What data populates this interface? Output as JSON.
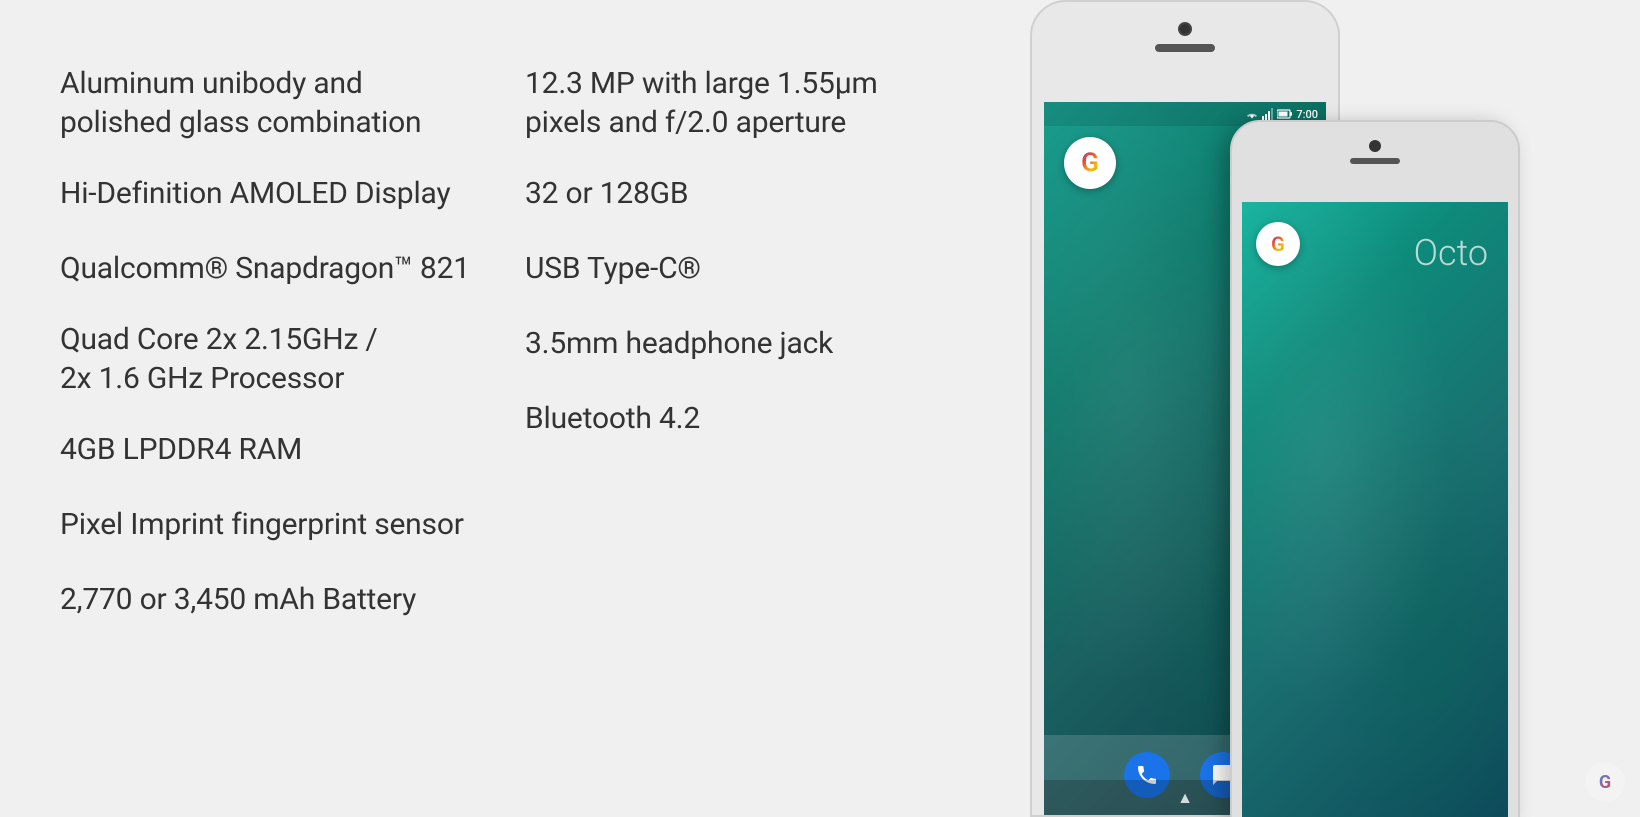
{
  "specs": {
    "left_column": [
      {
        "text": "Aluminum unibody and polished glass combination",
        "two_line": true
      },
      {
        "text": "Hi-Definition AMOLED Display",
        "two_line": false
      },
      {
        "text": "Qualcomm® Snapdragon™ 821",
        "two_line": false
      },
      {
        "text": "Quad Core 2x 2.15GHz / 2x 1.6 GHz Processor",
        "two_line": true
      },
      {
        "text": "4GB LPDDR4 RAM",
        "two_line": false
      },
      {
        "text": "Pixel Imprint fingerprint sensor",
        "two_line": false
      },
      {
        "text": "2,770 or 3,450 mAh Battery",
        "two_line": false
      }
    ],
    "right_column": [
      {
        "text": "12.3 MP with large 1.55μm pixels and f/2.0 aperture",
        "two_line": true
      },
      {
        "text": "32 or 128GB",
        "two_line": false
      },
      {
        "text": "USB Type-C®",
        "two_line": false
      },
      {
        "text": "3.5mm headphone jack",
        "two_line": false
      },
      {
        "text": "Bluetooth 4.2",
        "two_line": false
      }
    ]
  },
  "phone": {
    "status_time": "7:00",
    "google_letter": "G",
    "octo_label": "Octo",
    "nav_chevron": "▲"
  },
  "colors": {
    "background": "#f0f0f0",
    "text_primary": "#333333",
    "screen_teal": "#1a9e8f",
    "phone_body": "#e8e8e8"
  }
}
